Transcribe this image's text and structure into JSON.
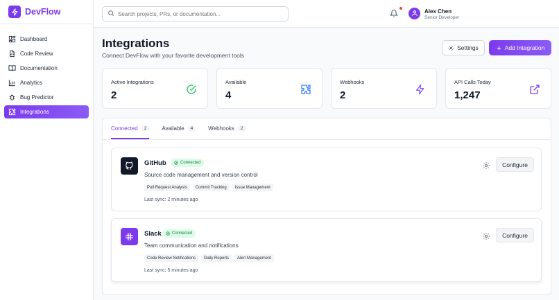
{
  "app": {
    "name": "DevFlow"
  },
  "search": {
    "placeholder": "Search projects, PRs, or documentation..."
  },
  "user": {
    "name": "Alex Chen",
    "role": "Senior Developer",
    "has_notification": true
  },
  "sidebar": {
    "items": [
      {
        "label": "Dashboard",
        "icon": "dashboard-icon",
        "active": false
      },
      {
        "label": "Code Review",
        "icon": "code-review-icon",
        "active": false
      },
      {
        "label": "Documentation",
        "icon": "book-icon",
        "active": false
      },
      {
        "label": "Analytics",
        "icon": "chart-icon",
        "active": false
      },
      {
        "label": "Bug Predictor",
        "icon": "bug-icon",
        "active": false
      },
      {
        "label": "Integrations",
        "icon": "puzzle-icon",
        "active": true
      }
    ]
  },
  "header": {
    "title": "Integrations",
    "subtitle": "Connect DevFlow with your favorite development tools",
    "settings_label": "Settings",
    "add_label": "Add Integration"
  },
  "stats": [
    {
      "label": "Active Integrations",
      "value": "2",
      "icon": "check-circle-icon",
      "color": "#22c55e"
    },
    {
      "label": "Available",
      "value": "4",
      "icon": "puzzle-icon",
      "color": "#3b82f6"
    },
    {
      "label": "Webhooks",
      "value": "2",
      "icon": "lightning-icon",
      "color": "#8b5cf6"
    },
    {
      "label": "API Calls Today",
      "value": "1,247",
      "icon": "external-link-icon",
      "color": "#7c3aed"
    }
  ],
  "tabs": [
    {
      "label": "Connected",
      "count": "2",
      "active": true
    },
    {
      "label": "Available",
      "count": "4",
      "active": false
    },
    {
      "label": "Webhooks",
      "count": "2",
      "active": false
    }
  ],
  "integrations": [
    {
      "name": "GitHub",
      "status": "Connected",
      "description": "Source code management and version control",
      "tags": [
        "Pull Request Analysis",
        "Commit Tracking",
        "Issue Management"
      ],
      "sync": "Last sync: 2 minutes ago",
      "configure_label": "Configure",
      "logo_color": "#111827",
      "icon": "github-icon"
    },
    {
      "name": "Slack",
      "status": "Connected",
      "description": "Team communication and notifications",
      "tags": [
        "Code Review Notifications",
        "Daily Reports",
        "Alert Management"
      ],
      "sync": "Last sync: 5 minutes ago",
      "configure_label": "Configure",
      "logo_color": "#7c3aed",
      "icon": "slack-icon"
    }
  ],
  "colors": {
    "accent": "#7c3aed",
    "success": "#22c55e",
    "danger": "#ef4444"
  }
}
